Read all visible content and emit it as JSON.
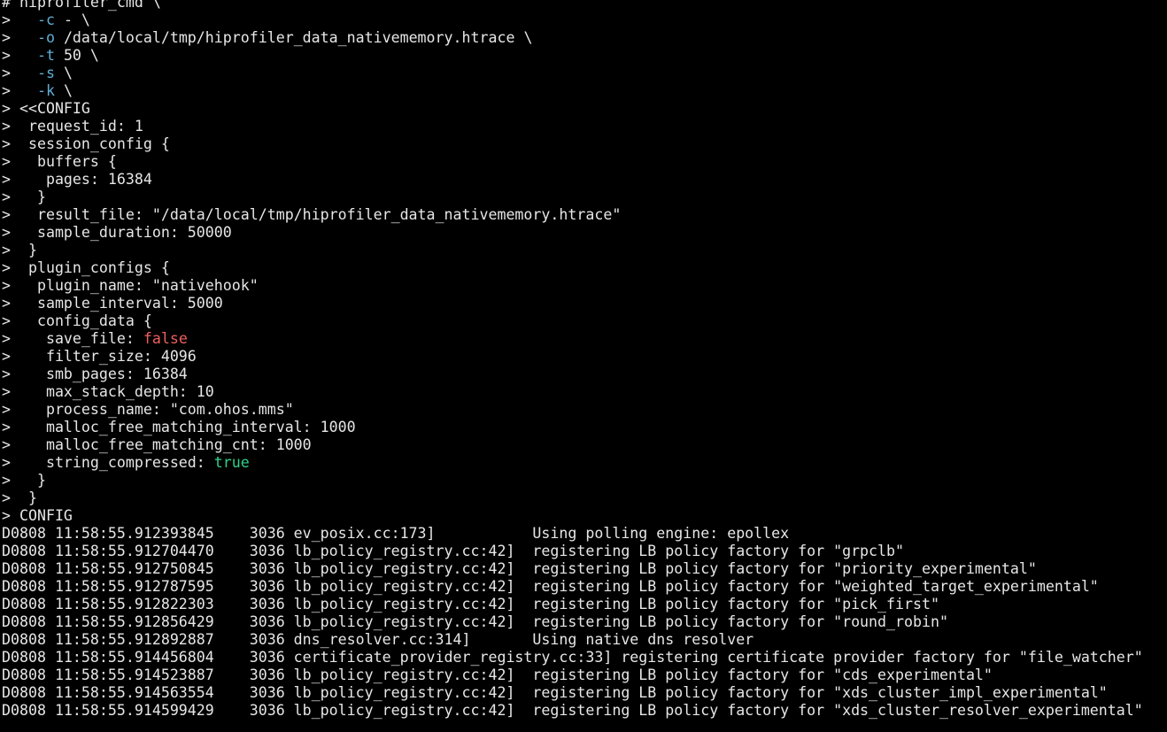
{
  "terminal": {
    "lines": [
      [
        {
          "t": "# hiprofiler_cmd \\"
        }
      ],
      [
        {
          "t": ">   "
        },
        {
          "t": "-c",
          "c": "flag"
        },
        {
          "t": " - \\"
        }
      ],
      [
        {
          "t": ">   "
        },
        {
          "t": "-o",
          "c": "flag"
        },
        {
          "t": " /data/local/tmp/hiprofiler_data_nativememory.htrace \\"
        }
      ],
      [
        {
          "t": ">   "
        },
        {
          "t": "-t",
          "c": "flag"
        },
        {
          "t": " 50 \\"
        }
      ],
      [
        {
          "t": ">   "
        },
        {
          "t": "-s",
          "c": "flag"
        },
        {
          "t": " \\"
        }
      ],
      [
        {
          "t": ">   "
        },
        {
          "t": "-k",
          "c": "flag"
        },
        {
          "t": " \\"
        }
      ],
      [
        {
          "t": "> <<CONFIG"
        }
      ],
      [
        {
          "t": ">  request_id: 1"
        }
      ],
      [
        {
          "t": ">  session_config {"
        }
      ],
      [
        {
          "t": ">   buffers {"
        }
      ],
      [
        {
          "t": ">    pages: 16384"
        }
      ],
      [
        {
          "t": ">   }"
        }
      ],
      [
        {
          "t": ">   result_file: \"/data/local/tmp/hiprofiler_data_nativememory.htrace\""
        }
      ],
      [
        {
          "t": ">   sample_duration: 50000"
        }
      ],
      [
        {
          "t": ">  }"
        }
      ],
      [
        {
          "t": ">  plugin_configs {"
        }
      ],
      [
        {
          "t": ">   plugin_name: \"nativehook\""
        }
      ],
      [
        {
          "t": ">   sample_interval: 5000"
        }
      ],
      [
        {
          "t": ">   config_data {"
        }
      ],
      [
        {
          "t": ">    save_file: "
        },
        {
          "t": "false",
          "c": "false"
        }
      ],
      [
        {
          "t": ">    filter_size: 4096"
        }
      ],
      [
        {
          "t": ">    smb_pages: 16384"
        }
      ],
      [
        {
          "t": ">    max_stack_depth: 10"
        }
      ],
      [
        {
          "t": ">    process_name: \"com.ohos.mms\""
        }
      ],
      [
        {
          "t": ">    malloc_free_matching_interval: 1000"
        }
      ],
      [
        {
          "t": ">    malloc_free_matching_cnt: 1000"
        }
      ],
      [
        {
          "t": ">    string_compressed: "
        },
        {
          "t": "true",
          "c": "true"
        }
      ],
      [
        {
          "t": ">   }"
        }
      ],
      [
        {
          "t": ">  }"
        }
      ],
      [
        {
          "t": "> CONFIG"
        }
      ],
      [
        {
          "t": "D0808 11:58:55.912393845    3036 ev_posix.cc:173]           Using polling engine: epollex"
        }
      ],
      [
        {
          "t": "D0808 11:58:55.912704470    3036 lb_policy_registry.cc:42]  registering LB policy factory for \"grpclb\""
        }
      ],
      [
        {
          "t": "D0808 11:58:55.912750845    3036 lb_policy_registry.cc:42]  registering LB policy factory for \"priority_experimental\""
        }
      ],
      [
        {
          "t": "D0808 11:58:55.912787595    3036 lb_policy_registry.cc:42]  registering LB policy factory for \"weighted_target_experimental\""
        }
      ],
      [
        {
          "t": "D0808 11:58:55.912822303    3036 lb_policy_registry.cc:42]  registering LB policy factory for \"pick_first\""
        }
      ],
      [
        {
          "t": "D0808 11:58:55.912856429    3036 lb_policy_registry.cc:42]  registering LB policy factory for \"round_robin\""
        }
      ],
      [
        {
          "t": "D0808 11:58:55.912892887    3036 dns_resolver.cc:314]       Using native dns resolver"
        }
      ],
      [
        {
          "t": "D0808 11:58:55.914456804    3036 certificate_provider_registry.cc:33] registering certificate provider factory for \"file_watcher\""
        }
      ],
      [
        {
          "t": "D0808 11:58:55.914523887    3036 lb_policy_registry.cc:42]  registering LB policy factory for \"cds_experimental\""
        }
      ],
      [
        {
          "t": "D0808 11:58:55.914563554    3036 lb_policy_registry.cc:42]  registering LB policy factory for \"xds_cluster_impl_experimental\""
        }
      ],
      [
        {
          "t": "D0808 11:58:55.914599429    3036 lb_policy_registry.cc:42]  registering LB policy factory for \"xds_cluster_resolver_experimental\""
        }
      ]
    ]
  },
  "colors": {
    "background": "#000000",
    "text": "#e6e6e6",
    "flag": "#5fafd7",
    "false_literal": "#ef5f5f",
    "true_literal": "#2fd08a"
  }
}
